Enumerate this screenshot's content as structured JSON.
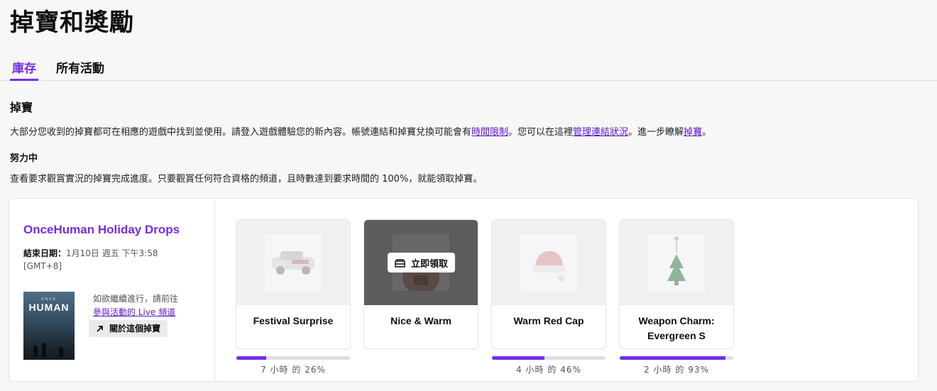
{
  "page": {
    "title": "掉寶和獎勵"
  },
  "tabs": [
    {
      "label": "庫存",
      "active": true
    },
    {
      "label": "所有活動",
      "active": false
    }
  ],
  "drops": {
    "title": "掉寶",
    "description": {
      "part1": "大部分您收到的掉寶都可在相應的遊戲中找到並使用。請登入遊戲體驗您的新內容。帳號連結和掉寶兌換可能會有",
      "link1": "時間限制",
      "part2": "。您可以在這裡",
      "link2": "管理連結狀況",
      "part3": "。進一步瞭解",
      "link3": "掉寶",
      "part4": "。"
    },
    "in_progress_title": "努力中",
    "in_progress_desc": "查看要求觀賞實況的掉寶完成進度。只要觀賞任何符合資格的頻道，且時數達到要求時間的 100%，就能領取掉寶。"
  },
  "campaign": {
    "title": "OnceHuman Holiday Drops",
    "end_label": "結束日期：",
    "end_value": "1月10日 週五 下午3:58 [GMT+8]",
    "game_art_small": "ONCE",
    "game_art_logo": "HUMAN",
    "continue_text": "如欲繼續進行，請前往",
    "continue_link": "參與活動的 Live 頻道",
    "about_label": "關於這個掉寶",
    "accent_color": "#772ce8",
    "rewards": [
      {
        "name": "Festival Surprise",
        "progress": 26,
        "progress_label": "7 小時 的 26%",
        "claimable": false
      },
      {
        "name": "Nice & Warm",
        "claimable": true,
        "claim_label": "立即領取"
      },
      {
        "name": "Warm Red Cap",
        "progress": 46,
        "progress_label": "4 小時 的 46%",
        "claimable": false
      },
      {
        "name": "Weapon Charm: Evergreen S",
        "progress": 93,
        "progress_label": "2 小時 的 93%",
        "claimable": false
      }
    ]
  }
}
